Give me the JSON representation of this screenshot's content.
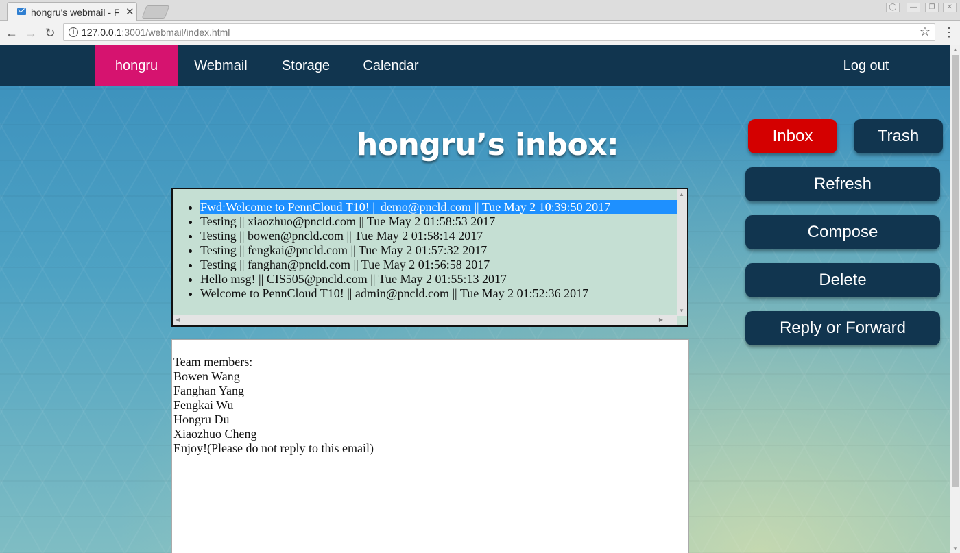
{
  "browser": {
    "tab_title": "hongru's webmail - F",
    "url_host": "127.0.0.1",
    "url_rest": ":3001/webmail/index.html"
  },
  "navbar": {
    "user": "hongru",
    "webmail": "Webmail",
    "storage": "Storage",
    "calendar": "Calendar",
    "logout": "Log out"
  },
  "title": "hongru’s inbox:",
  "emails": [
    "Fwd:Welcome to PennCloud T10! || demo@pncld.com || Tue May 2 10:39:50 2017",
    "Testing || xiaozhuo@pncld.com || Tue May 2 01:58:53 2017",
    "Testing || bowen@pncld.com || Tue May 2 01:58:14 2017",
    "Testing || fengkai@pncld.com || Tue May 2 01:57:32 2017",
    "Testing || fanghan@pncld.com || Tue May 2 01:56:58 2017",
    "Hello msg! || CIS505@pncld.com || Tue May 2 01:55:13 2017",
    "Welcome to PennCloud T10! || admin@pncld.com || Tue May 2 01:52:36 2017"
  ],
  "selected_index": 0,
  "body_lines": [
    "Team members:",
    "Bowen Wang",
    "Fanghan Yang",
    "Fengkai Wu",
    "Hongru Du",
    "Xiaozhuo Cheng",
    "Enjoy!(Please do not reply to this email)"
  ],
  "buttons": {
    "inbox": "Inbox",
    "trash": "Trash",
    "refresh": "Refresh",
    "compose": "Compose",
    "delete": "Delete",
    "reply_forward": "Reply or Forward"
  },
  "colors": {
    "navbar": "#11354f",
    "active_nav": "#d6136f",
    "inbox_button": "#d40000",
    "selected_row": "#1e90ff"
  }
}
